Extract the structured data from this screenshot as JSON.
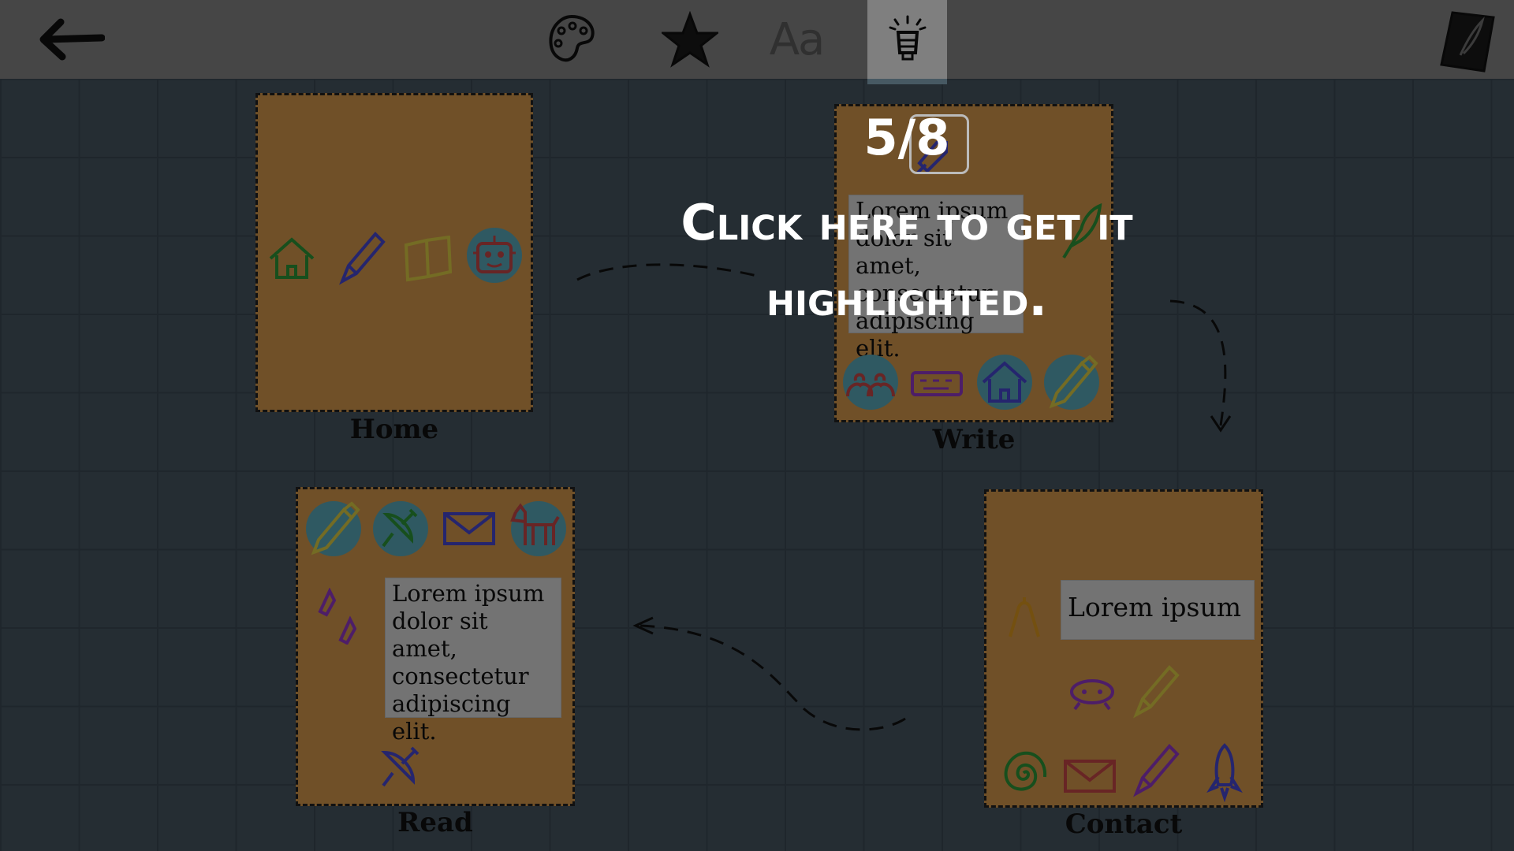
{
  "toolbar": {
    "back": "back-arrow-icon",
    "palette": "palette-icon",
    "star": "star-icon",
    "font_label": "Aa",
    "lamp": "lamp-icon",
    "notebook": "notebook-icon"
  },
  "pages": {
    "home": {
      "label": "Home"
    },
    "write": {
      "label": "Write",
      "text": "Lorem ipsum dolor sit amet, consectetur adipiscing elit."
    },
    "read": {
      "label": "Read",
      "text": "Lorem ipsum dolor sit amet, consectetur adipiscing elit."
    },
    "contact": {
      "label": "Contact",
      "text": "Lorem ipsum"
    }
  },
  "tutorial": {
    "step": "5/8",
    "message": "Click here to get it highlighted."
  },
  "colors": {
    "toolbar": "#8c8c8c",
    "page": "#e0a050",
    "grid": "#4a5a66",
    "active_tab_underline": "#8fb2c6"
  }
}
